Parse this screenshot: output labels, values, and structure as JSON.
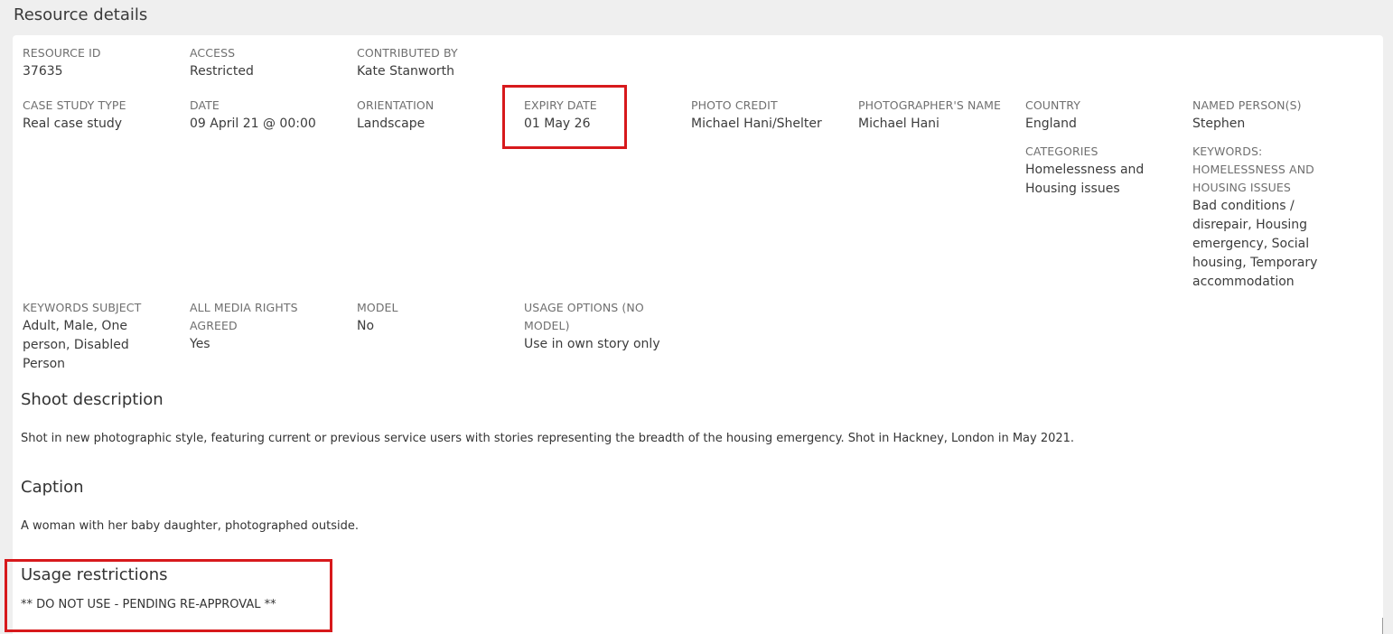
{
  "panel": {
    "title": "Resource details"
  },
  "fields": {
    "resource_id": {
      "label": "RESOURCE ID",
      "value": "37635"
    },
    "access": {
      "label": "ACCESS",
      "value": "Restricted"
    },
    "contributed_by": {
      "label": "CONTRIBUTED BY",
      "value": "Kate Stanworth"
    },
    "case_study_type": {
      "label": "CASE STUDY TYPE",
      "value": "Real case study"
    },
    "date": {
      "label": "DATE",
      "value": "09 April 21 @ 00:00"
    },
    "orientation": {
      "label": "ORIENTATION",
      "value": "Landscape"
    },
    "expiry_date": {
      "label": "EXPIRY DATE",
      "value": "01 May 26"
    },
    "photo_credit": {
      "label": "PHOTO CREDIT",
      "value": "Michael Hani/Shelter"
    },
    "photographers_name": {
      "label": "PHOTOGRAPHER'S NAME",
      "value": "Michael Hani"
    },
    "country": {
      "label": "COUNTRY",
      "value": "England"
    },
    "named_persons": {
      "label": "NAMED PERSON(S)",
      "value": "Stephen"
    },
    "categories": {
      "label": "CATEGORIES",
      "value": "Homelessness and Housing issues"
    },
    "keywords_homelessness": {
      "label": "KEYWORDS: HOMELESSNESS AND HOUSING ISSUES",
      "value": "Bad conditions / disrepair, Housing emergency, Social housing, Temporary accommodation"
    },
    "keywords_subject": {
      "label": "KEYWORDS SUBJECT",
      "value": "Adult, Male, One person, Disabled Person"
    },
    "all_media_rights": {
      "label": "ALL MEDIA RIGHTS AGREED",
      "value": "Yes"
    },
    "model": {
      "label": "MODEL",
      "value": "No"
    },
    "usage_options": {
      "label": "USAGE OPTIONS (NO MODEL)",
      "value": "Use in own story only"
    }
  },
  "sections": {
    "shoot_description": {
      "heading": "Shoot description",
      "text": "Shot in new photographic style, featuring current or previous service users with stories representing the breadth of the housing emergency. Shot in Hackney, London in May 2021."
    },
    "caption": {
      "heading": "Caption",
      "text": "A woman with her baby daughter, photographed outside."
    },
    "usage_restrictions": {
      "heading": "Usage restrictions",
      "text": "** DO NOT USE - PENDING RE-APPROVAL **"
    }
  },
  "colors": {
    "highlight": "#d7191c",
    "panel_bg": "#efefef",
    "card_bg": "#ffffff",
    "label_text": "#6f6f6f"
  }
}
